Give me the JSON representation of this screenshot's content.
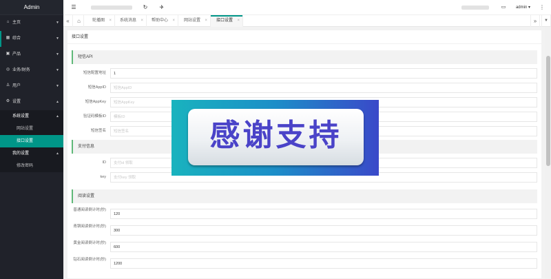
{
  "app": {
    "brand": "Admin"
  },
  "sidebar": {
    "items": [
      {
        "label": "主页",
        "icon": "home-icon"
      },
      {
        "label": "综合",
        "icon": "grid-icon"
      },
      {
        "label": "产品",
        "icon": "box-icon"
      },
      {
        "label": "业务/财务",
        "icon": "money-icon"
      },
      {
        "label": "用户",
        "icon": "user-icon"
      },
      {
        "label": "设置",
        "icon": "gear-icon"
      }
    ],
    "settings_groups": [
      {
        "label": "系统设置",
        "children": [
          "网站设置",
          "接口设置"
        ]
      },
      {
        "label": "我的设置",
        "children": [
          "修改密码"
        ]
      }
    ],
    "active_child": "接口设置"
  },
  "header": {
    "user": "admin ▾"
  },
  "tabs": [
    {
      "label": "轮播图"
    },
    {
      "label": "系统消息"
    },
    {
      "label": "帮助中心"
    },
    {
      "label": "网站设置"
    },
    {
      "label": "接口设置"
    }
  ],
  "page": {
    "title": "接口设置",
    "sections": [
      {
        "title": "短信API",
        "fields": [
          {
            "label": "短信配置地址",
            "value": "1",
            "placeholder": ""
          },
          {
            "label": "短信AppID",
            "value": "",
            "placeholder": "短信AppID"
          },
          {
            "label": "短信AppKey",
            "value": "",
            "placeholder": "短信AppKey"
          },
          {
            "label": "验证码模板ID",
            "value": "",
            "placeholder": "模板ID"
          },
          {
            "label": "短信签名",
            "value": "",
            "placeholder": "短信签名"
          }
        ]
      },
      {
        "title": "支付信息",
        "fields": [
          {
            "label": "ID",
            "value": "",
            "placeholder": "支付id 领取"
          },
          {
            "label": "key",
            "value": "",
            "placeholder": "支付key 领取"
          }
        ]
      },
      {
        "title": "阅读设置",
        "fields": [
          {
            "label": "普通阅读倒计时(秒)",
            "value": "120"
          },
          {
            "label": "青铜阅读倒计时(秒)",
            "value": "300"
          },
          {
            "label": "黄金阅读倒计时(秒)",
            "value": "600"
          },
          {
            "label": "钻石阅读倒计时(秒)",
            "value": "1200"
          }
        ]
      }
    ]
  },
  "banner": {
    "text": "感谢支持"
  },
  "colors": {
    "accent": "#009688",
    "sidebar_bg": "#20222a",
    "section_marker": "#5fb878",
    "banner_text": "#4a43c8"
  }
}
